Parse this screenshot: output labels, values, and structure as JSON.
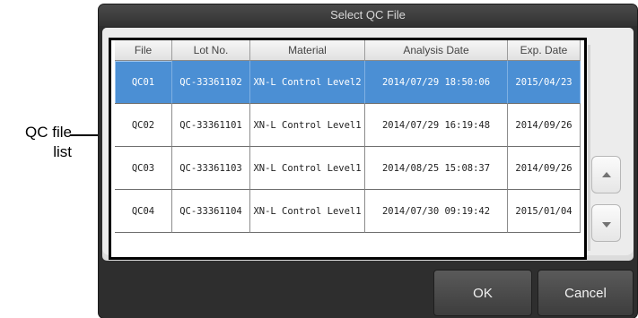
{
  "callout": {
    "label_line1": "QC file",
    "label_line2": "list"
  },
  "dialog": {
    "title": "Select QC File"
  },
  "table": {
    "headers": [
      "File",
      "Lot No.",
      "Material",
      "Analysis Date",
      "Exp. Date"
    ],
    "rows": [
      [
        "QC01",
        "QC-33361102",
        "XN-L Control Level2",
        "2014/07/29 18:50:06",
        "2015/04/23"
      ],
      [
        "QC02",
        "QC-33361101",
        "XN-L Control Level1",
        "2014/07/29 16:19:48",
        "2014/09/26"
      ],
      [
        "QC03",
        "QC-33361103",
        "XN-L Control Level1",
        "2014/08/25 15:08:37",
        "2014/09/26"
      ],
      [
        "QC04",
        "QC-33361104",
        "XN-L Control Level1",
        "2014/07/30 09:19:42",
        "2015/01/04"
      ]
    ],
    "selected_row": 0
  },
  "buttons": {
    "ok": "OK",
    "cancel": "Cancel"
  },
  "icons": {
    "scroll_up": "triangle-up-icon",
    "scroll_down": "triangle-down-icon"
  },
  "colors": {
    "selection": "#4b8fd4",
    "dialog_bg": "#2e2e2e"
  }
}
